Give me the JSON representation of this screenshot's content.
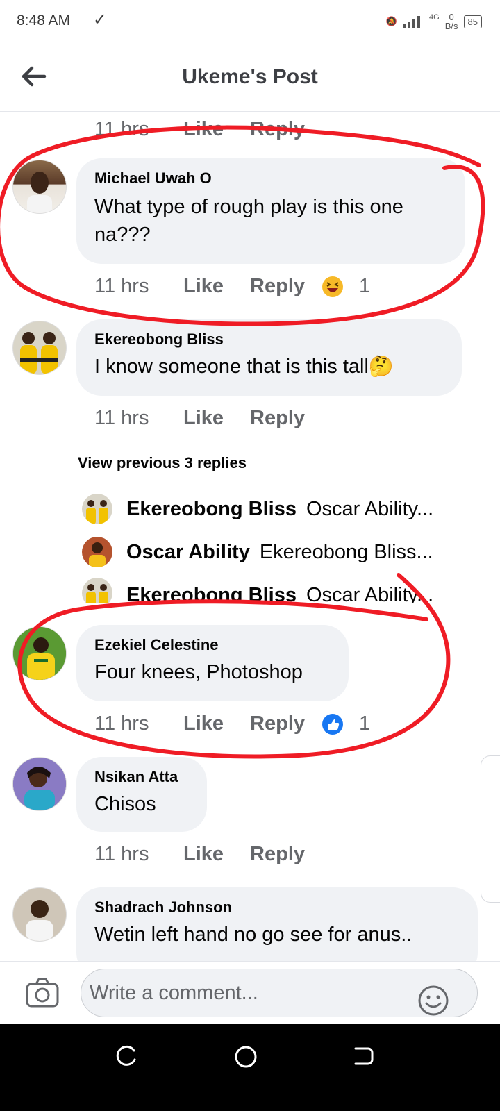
{
  "status_bar": {
    "time": "8:48 AM",
    "network": "4G",
    "speed_value": "0",
    "speed_unit": "B/s",
    "battery": "85"
  },
  "header": {
    "title": "Ukeme's Post"
  },
  "top_partial": {
    "time": "11 hrs",
    "like": "Like",
    "reply": "Reply"
  },
  "comments": [
    {
      "name": "Michael Uwah O",
      "text": "What type of rough play is this one na???",
      "time": "11 hrs",
      "like": "Like",
      "reply": "Reply",
      "reaction": "laughing-emoji",
      "reaction_count": "1"
    },
    {
      "name": "Ekereobong Bliss",
      "text": "I know someone that is this tall🤔",
      "time": "11 hrs",
      "like": "Like",
      "reply": "Reply"
    },
    {
      "name": "Ezekiel Celestine",
      "text": "Four knees, Photoshop",
      "time": "11 hrs",
      "like": "Like",
      "reply": "Reply",
      "reaction": "like-thumb",
      "reaction_count": "1"
    },
    {
      "name": "Nsikan Atta",
      "text": "Chisos",
      "time": "11 hrs",
      "like": "Like",
      "reply": "Reply"
    },
    {
      "name": "Shadrach Johnson",
      "text": "Wetin left hand no go see for anus.."
    }
  ],
  "view_previous": "View previous 3 replies",
  "replies": [
    {
      "name": "Ekereobong Bliss",
      "text": "Oscar Ability..."
    },
    {
      "name": "Oscar Ability",
      "text": "Ekereobong Bliss..."
    },
    {
      "name": "Ekereobong Bliss",
      "text": "Oscar Ability..."
    }
  ],
  "composer": {
    "placeholder": "Write a comment..."
  },
  "colors": {
    "accent_blue": "#1877f2",
    "bubble": "#f0f2f5",
    "annotation_red": "#ef1c25"
  }
}
